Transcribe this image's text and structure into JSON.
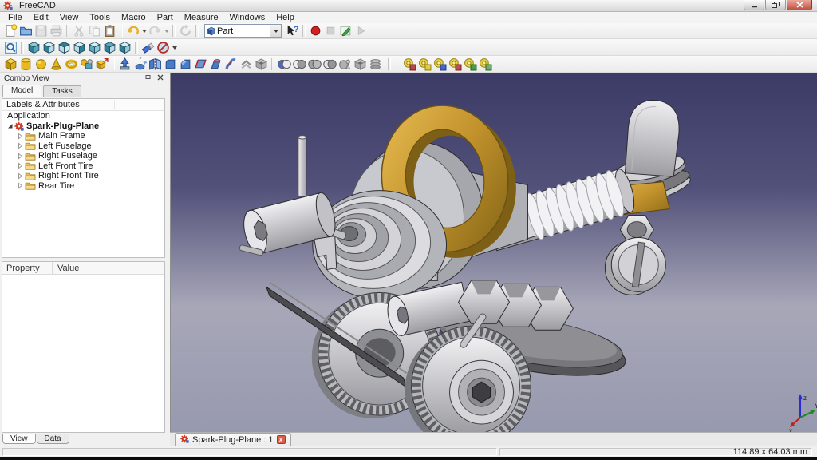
{
  "titlebar": {
    "title": "FreeCAD",
    "buttons": [
      {
        "name": "minimize-button"
      },
      {
        "name": "restore-button"
      },
      {
        "name": "close-button"
      }
    ]
  },
  "menubar": {
    "items": [
      "File",
      "Edit",
      "View",
      "Tools",
      "Macro",
      "Part",
      "Measure",
      "Windows",
      "Help"
    ]
  },
  "toolbars": {
    "workbench": {
      "label": "Part"
    },
    "row1a": [
      {
        "name": "new-document",
        "shape": "page"
      },
      {
        "name": "open-document",
        "shape": "folder"
      },
      {
        "name": "save-document",
        "shape": "disk",
        "disabled": true
      },
      {
        "name": "print",
        "shape": "printer",
        "disabled": true
      },
      {
        "sep": true
      },
      {
        "name": "cut",
        "shape": "scissors",
        "disabled": true
      },
      {
        "name": "copy",
        "shape": "copy",
        "disabled": true
      },
      {
        "name": "paste",
        "shape": "clipboard"
      },
      {
        "sep": true
      },
      {
        "name": "undo",
        "shape": "undo"
      },
      {
        "name": "undo-options",
        "shape": "chevron"
      },
      {
        "name": "redo",
        "shape": "redo",
        "disabled": true
      },
      {
        "name": "redo-options",
        "shape": "chevron",
        "disabled": true
      },
      {
        "sep": true
      },
      {
        "name": "refresh",
        "shape": "refresh",
        "disabled": true
      },
      {
        "sep": true
      }
    ],
    "row1b": [
      {
        "name": "whats-this",
        "shape": "whatsthis"
      },
      {
        "sep": true
      },
      {
        "name": "macro-record",
        "shape": "record"
      },
      {
        "name": "macro-stop",
        "shape": "stop",
        "disabled": true
      },
      {
        "name": "macro-edit",
        "shape": "macroedit"
      },
      {
        "name": "macro-play",
        "shape": "play",
        "disabled": true
      }
    ],
    "row2": [
      {
        "name": "fit-all",
        "shape": "fitall"
      },
      {
        "sep": true
      },
      {
        "name": "axonometric-view",
        "shape": "cube",
        "c": [
          "#8ecadb",
          "#2e7f96",
          "#5ba8bd"
        ]
      },
      {
        "name": "front-view",
        "shape": "cube",
        "c": [
          "#dcedf2",
          "#2e7f96",
          "#bcdde8"
        ]
      },
      {
        "name": "top-view",
        "shape": "cube",
        "c": [
          "#2e7f96",
          "#bcdde8",
          "#dcedf2"
        ]
      },
      {
        "name": "right-view",
        "shape": "cube",
        "c": [
          "#dcedf2",
          "#bcdde8",
          "#2e7f96"
        ]
      },
      {
        "name": "rear-view",
        "shape": "cube",
        "c": [
          "#dcedf2",
          "#5ba8bd",
          "#8ecadb"
        ]
      },
      {
        "name": "bottom-view",
        "shape": "cube",
        "c": [
          "#5ba8bd",
          "#2e7f96",
          "#bcdde8"
        ]
      },
      {
        "name": "left-view",
        "shape": "cube",
        "c": [
          "#dcedf2",
          "#2e7f96",
          "#8ecadb"
        ]
      },
      {
        "sep": true
      },
      {
        "name": "draw-style",
        "shape": "eraser"
      },
      {
        "name": "turn-off-style",
        "shape": "ban"
      },
      {
        "name": "draw-style-options",
        "shape": "chevron"
      }
    ],
    "row3": [
      {
        "name": "primitive-box",
        "shape": "pbox"
      },
      {
        "name": "primitive-cylinder",
        "shape": "pcyl"
      },
      {
        "name": "primitive-sphere",
        "shape": "psph"
      },
      {
        "name": "primitive-cone",
        "shape": "pcone"
      },
      {
        "name": "primitive-torus",
        "shape": "ptorus"
      },
      {
        "name": "shape-builder",
        "shape": "pshapes"
      },
      {
        "name": "primitives-dialog",
        "shape": "pdlg"
      },
      {
        "sep": true
      },
      {
        "name": "extrude",
        "shape": "extrude"
      },
      {
        "name": "revolve",
        "shape": "revolve"
      },
      {
        "name": "mirror",
        "shape": "mirror"
      },
      {
        "name": "fillet",
        "shape": "fillet"
      },
      {
        "name": "chamfer",
        "shape": "chamfer"
      },
      {
        "name": "ruled-surface",
        "shape": "ruled"
      },
      {
        "name": "loft",
        "shape": "loft"
      },
      {
        "name": "sweep",
        "shape": "sweep"
      },
      {
        "name": "offset",
        "shape": "offset"
      },
      {
        "name": "thickness",
        "shape": "thickness"
      },
      {
        "sep": true
      },
      {
        "name": "boolean-operation",
        "shape": "boolpair",
        "c": [
          "#4a66d8",
          "#ececef"
        ]
      },
      {
        "name": "boolean-cut",
        "shape": "boolpair",
        "c": [
          "#f0f0f2",
          "#9a9a9e"
        ]
      },
      {
        "name": "boolean-union",
        "shape": "boolpair",
        "c": [
          "#a2a2a6",
          "#babbbf"
        ]
      },
      {
        "name": "boolean-intersection",
        "shape": "boolpair",
        "c": [
          "#e6e6ea",
          "#95959a"
        ]
      },
      {
        "name": "join-connect",
        "shape": "connect"
      },
      {
        "name": "make-compound",
        "shape": "thickness"
      },
      {
        "name": "cross-sections",
        "shape": "compound"
      },
      {
        "sep": true,
        "wide": true
      },
      {
        "name": "measure-linear",
        "shape": "measure",
        "c": [
          "#b84848",
          "#7c2020"
        ]
      },
      {
        "name": "measure-angular",
        "shape": "measure",
        "c": [
          "#e0cc46",
          "#96820e"
        ]
      },
      {
        "name": "measure-refresh",
        "shape": "measure",
        "c": [
          "#4868c8",
          "#223c8e"
        ]
      },
      {
        "name": "clear-measurement",
        "shape": "measure",
        "c": [
          "#c05050",
          "#802020"
        ]
      },
      {
        "name": "toggle-measurement-3d",
        "shape": "measure",
        "c": [
          "#44a044",
          "#1e6a1e"
        ]
      },
      {
        "name": "toggle-measurement-delta",
        "shape": "measure",
        "c": [
          "#70b070",
          "#2e6a2e"
        ]
      }
    ]
  },
  "dock": {
    "title": "Combo View",
    "tabs": [
      {
        "label": "Model",
        "active": true
      },
      {
        "label": "Tasks",
        "active": false
      }
    ],
    "tree_header": "Labels & Attributes",
    "tree": {
      "root": "Application",
      "document": "Spark-Plug-Plane",
      "items": [
        "Main Frame",
        "Left Fuselage",
        "Right Fuselage",
        "Left Front Tire",
        "Right Front Tire",
        "Rear Tire"
      ]
    },
    "properties": {
      "columns": [
        "Property",
        "Value"
      ],
      "rows": []
    },
    "bottom_tabs": [
      {
        "label": "View",
        "active": true
      },
      {
        "label": "Data",
        "active": false
      }
    ]
  },
  "mdi": {
    "tab_label": "Spark-Plug-Plane : 1"
  },
  "viewport": {
    "axis": {
      "x": "x",
      "y": "Y",
      "z": "z"
    },
    "model_name": "Spark-Plug-Plane"
  },
  "statusbar": {
    "dimensions": "114.89 x 64.03 mm"
  },
  "colors": {
    "viewport_top": "#3c3b66",
    "viewport_bottom": "#9799ae",
    "model_metal": "#c8c9ce",
    "model_brass": "#c2922c",
    "tab_close_red": "#dd5f4b"
  }
}
